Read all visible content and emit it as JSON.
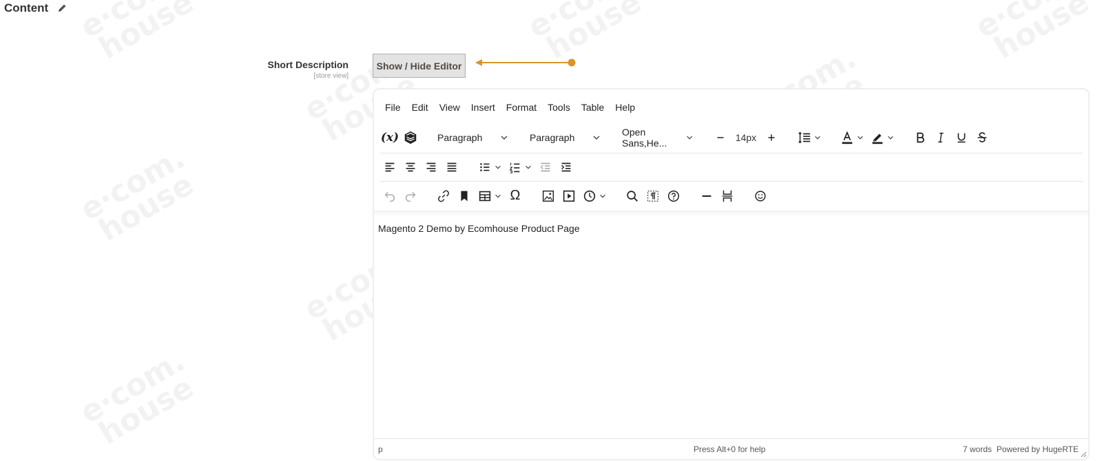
{
  "watermark_text": "e·com.\nhouse",
  "section": {
    "title": "Content"
  },
  "field": {
    "label": "Short Description",
    "scope": "[store view]",
    "toggle_label": "Show / Hide Editor"
  },
  "colors": {
    "arrow": "#d9952b",
    "button_bg": "#e3e3e3"
  },
  "editor": {
    "menu": [
      "File",
      "Edit",
      "View",
      "Insert",
      "Format",
      "Tools",
      "Table",
      "Help"
    ],
    "block_select_1": "Paragraph",
    "block_select_2": "Paragraph",
    "font_family": "Open Sans,He...",
    "font_size": "14px",
    "icons": {
      "variables": "(x)",
      "special_char": "Ω"
    },
    "content_text": "Magento 2 Demo by Ecomhouse Product Page",
    "status": {
      "path": "p",
      "help": "Press Alt+0 for help",
      "words": "7 words",
      "powered": "Powered by HugeRTE"
    }
  }
}
